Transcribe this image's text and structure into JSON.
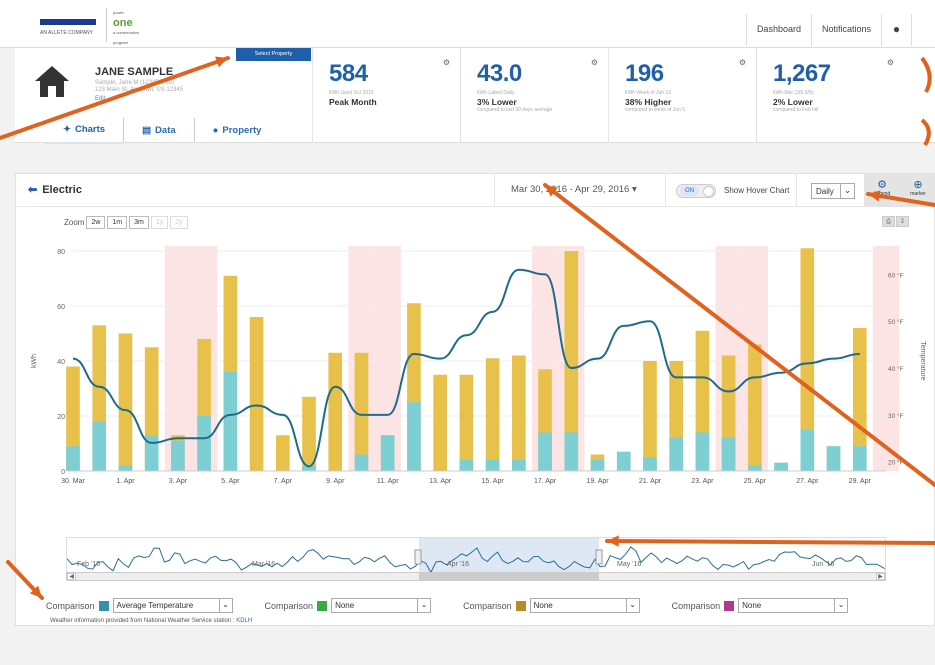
{
  "topnav": {
    "dashboard": "Dashboard",
    "notifications": "Notifications",
    "user_icon": "user-icon"
  },
  "logos": {
    "mp_caption": "AN ALLETE COMPANY",
    "po_name": "one",
    "po_prefix": "power",
    "po_caption": "a conservation program"
  },
  "property": {
    "name": "JANE SAMPLE",
    "address_line1": "Sample, Jane M (123456789)",
    "address_line2": "123 Main St, Anytown, US 12345",
    "edit": "Edit",
    "select_button": "Select Property"
  },
  "tabs": [
    {
      "label": "Charts",
      "icon": "chart-icon"
    },
    {
      "label": "Data",
      "icon": "document-icon"
    },
    {
      "label": "Property",
      "icon": "map-pin-icon"
    }
  ],
  "stats": [
    {
      "value": "584",
      "sub": "kWh Used Oct 2015",
      "compare": "Peak Month",
      "note": ""
    },
    {
      "value": "43.0",
      "sub": "kWh Latest Daily",
      "compare": "3% Lower",
      "note": "compared to last 30 days average"
    },
    {
      "value": "196",
      "sub": "kWh Week of Jun 12",
      "compare": "38% Higher",
      "note": "compared to week of Jun 5"
    },
    {
      "value": "1,267",
      "sub": "kWh Mar (3/9-3/9)",
      "compare": "2% Lower",
      "note": "compared to Feb bill"
    }
  ],
  "panel": {
    "title": "Electric",
    "date_range": "Mar 30, 2016 - Apr 29, 2016",
    "toggle_on": "ON",
    "hover_label": "Show Hover Chart",
    "period": "Daily",
    "legend_btn": "Legend",
    "marker_btn": "marker"
  },
  "zoom": {
    "label": "Zoom",
    "options": [
      "2w",
      "1m",
      "3m",
      "1y",
      "2y"
    ]
  },
  "colors": {
    "bar_total": "#e8c14b",
    "bar_base": "#7ecfd4",
    "temp_line": "#1f6b8a",
    "weekend": "#fde4e4",
    "brand": "#1f5fa8",
    "arrow": "#e0621f"
  },
  "chart_data": {
    "type": "bar",
    "x_labels": [
      "30. Mar",
      "1. Apr",
      "3. Apr",
      "5. Apr",
      "7. Apr",
      "9. Apr",
      "11. Apr",
      "13. Apr",
      "15. Apr",
      "17. Apr",
      "19. Apr",
      "21. Apr",
      "23. Apr",
      "25. Apr",
      "27. Apr",
      "29. Apr"
    ],
    "ylabel": "kWh",
    "y2label": "Temperature",
    "y_ticks": [
      "0",
      "20",
      "40",
      "60",
      "80"
    ],
    "y2_ticks": [
      "20 °F",
      "30 °F",
      "40 °F",
      "50 °F",
      "60 °F"
    ],
    "ylim": [
      0,
      80
    ],
    "y2lim": [
      18,
      65
    ],
    "usage_total": [
      38,
      53,
      50,
      45,
      13,
      48,
      71,
      56,
      13,
      27,
      43,
      43,
      13,
      61,
      35,
      35,
      41,
      42,
      37,
      80,
      6,
      7,
      40,
      40,
      51,
      42,
      46,
      3,
      81,
      9,
      52
    ],
    "usage_base": [
      9,
      18,
      2,
      13,
      11,
      20,
      36,
      0,
      0,
      2,
      0,
      6,
      13,
      25,
      0,
      4,
      4,
      4,
      14,
      14,
      4,
      7,
      5,
      12,
      14,
      12,
      2,
      3,
      15,
      9,
      9
    ],
    "weekend_days": [
      4,
      5,
      11,
      12,
      18,
      19,
      25,
      26,
      31
    ],
    "temperature": [
      42,
      36,
      31,
      24,
      25,
      25,
      30,
      32,
      30,
      19,
      36,
      30,
      30,
      43,
      42,
      47,
      52,
      61,
      60,
      40,
      42,
      49,
      50,
      38,
      38,
      35,
      38,
      39,
      41,
      42,
      43
    ]
  },
  "navigator": {
    "labels": [
      "Feb '16",
      "Mar '16",
      "Apr '16",
      "May '16",
      "Jun '16"
    ],
    "handle": "III"
  },
  "comparisons": [
    {
      "label": "Comparison",
      "color": "#3a8fb0",
      "value": "Average Temperature"
    },
    {
      "label": "Comparison",
      "color": "#3aa843",
      "value": "None"
    },
    {
      "label": "Comparison",
      "color": "#b88a2c",
      "value": "None"
    },
    {
      "label": "Comparison",
      "color": "#b03a8a",
      "value": "None"
    }
  ],
  "weather": {
    "text": "Weather information provided from National Weather Service station : ",
    "station": "KDLH"
  }
}
